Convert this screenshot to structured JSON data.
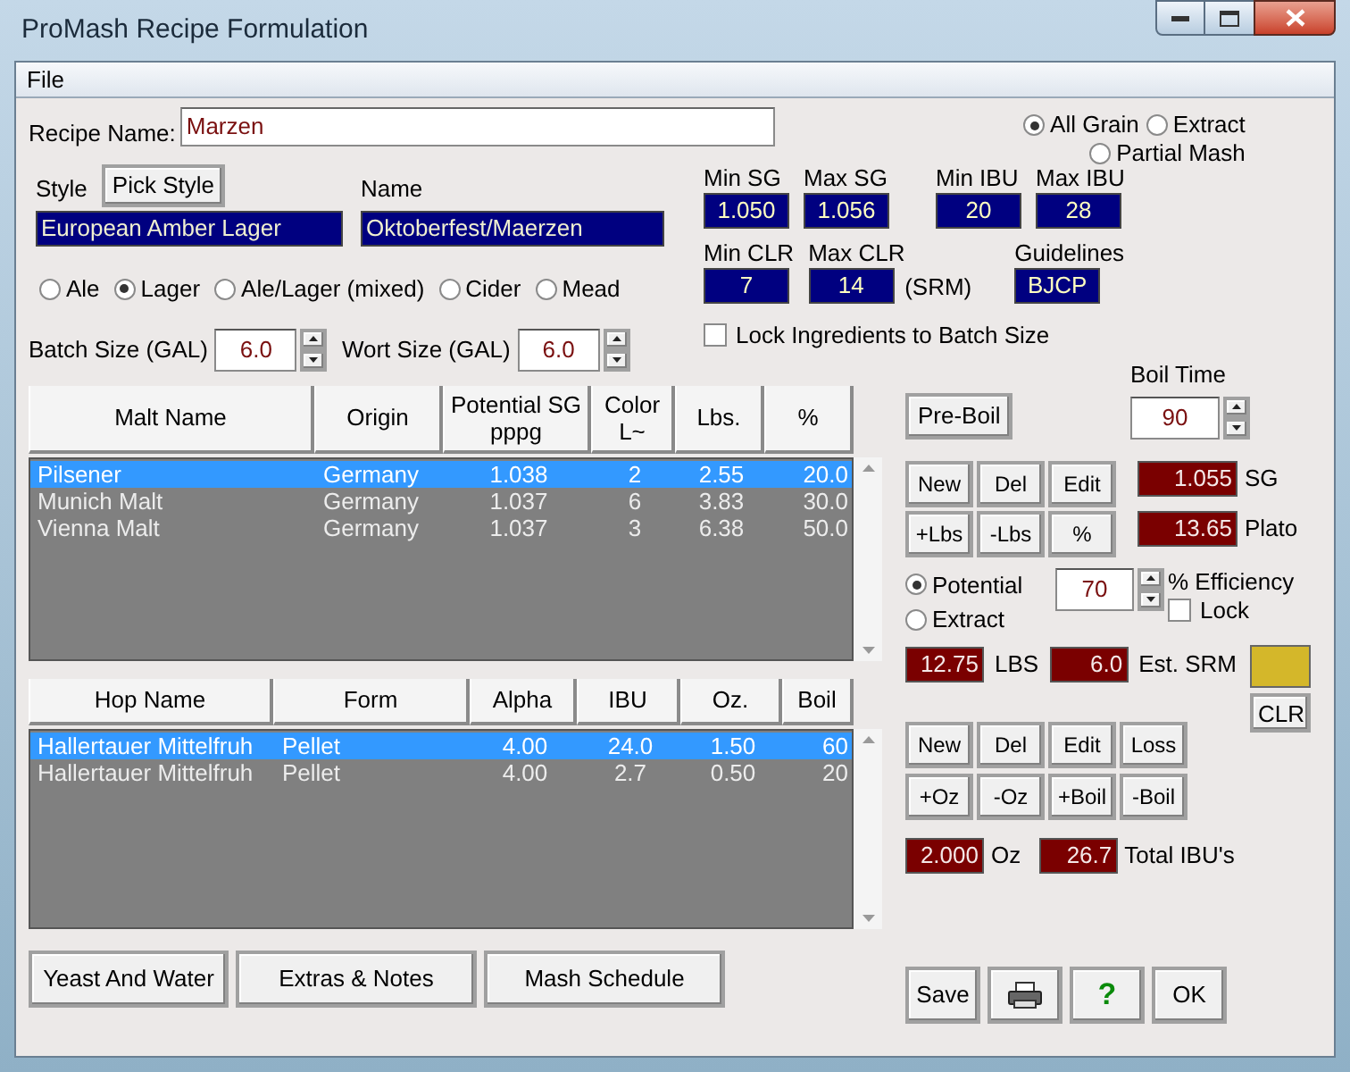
{
  "window": {
    "title": "ProMash Recipe Formulation"
  },
  "menu": [
    "File"
  ],
  "recipe_name": {
    "label": "Recipe Name:",
    "value": "Marzen"
  },
  "recipe_types": [
    {
      "label": "All Grain",
      "selected": true
    },
    {
      "label": "Extract",
      "selected": false
    },
    {
      "label": "Partial Mash",
      "selected": false
    }
  ],
  "style": {
    "label": "Style",
    "button": "Pick Style",
    "value": "European Amber Lager",
    "name_label": "Name",
    "name_value": "Oktoberfest/Maerzen"
  },
  "specs_row_1": [
    {
      "label": "Min SG",
      "value": "1.050"
    },
    {
      "label": "Max SG",
      "value": "1.056"
    },
    {
      "label": "Min IBU",
      "value": "20"
    },
    {
      "label": "Max IBU",
      "value": "28"
    }
  ],
  "specs_row_2": [
    {
      "label": "Min CLR",
      "value": "7"
    },
    {
      "label": "Max CLR",
      "value": "14"
    },
    {
      "label": "Guidelines",
      "value": "BJCP"
    }
  ],
  "color_unit": "(SRM)",
  "beer_types": [
    {
      "label": "Ale",
      "selected": false
    },
    {
      "label": "Lager",
      "selected": true
    },
    {
      "label": "Ale/Lager (mixed)",
      "selected": false
    },
    {
      "label": "Cider",
      "selected": false
    },
    {
      "label": "Mead",
      "selected": false
    }
  ],
  "batch_size": {
    "label": "Batch Size (GAL)",
    "value": "6.0"
  },
  "wort_size": {
    "label": "Wort Size (GAL)",
    "value": "6.0"
  },
  "lock_ingredients": {
    "label": "Lock Ingredients to Batch Size",
    "checked": false
  },
  "malt_table": {
    "columns": [
      "Malt Name",
      "Origin",
      "Potential SG pppg",
      "Color L~",
      "Lbs.",
      "%"
    ],
    "rows": [
      {
        "cells": [
          "Pilsener",
          "Germany",
          "1.038",
          "2",
          "2.55",
          "20.0"
        ],
        "selected": true
      },
      {
        "cells": [
          "Munich Malt",
          "Germany",
          "1.037",
          "6",
          "3.83",
          "30.0"
        ],
        "selected": false
      },
      {
        "cells": [
          "Vienna Malt",
          "Germany",
          "1.037",
          "3",
          "6.38",
          "50.0"
        ],
        "selected": false
      }
    ]
  },
  "hop_table": {
    "columns": [
      "Hop Name",
      "Form",
      "Alpha",
      "IBU",
      "Oz.",
      "Boil"
    ],
    "rows": [
      {
        "cells": [
          "Hallertauer Mittelfruh",
          "Pellet",
          "4.00",
          "24.0",
          "1.50",
          "60"
        ],
        "selected": true
      },
      {
        "cells": [
          "Hallertauer Mittelfruh",
          "Pellet",
          "4.00",
          "2.7",
          "0.50",
          "20"
        ],
        "selected": false
      }
    ]
  },
  "bottom_buttons": [
    "Yeast And Water",
    "Extras & Notes",
    "Mash Schedule"
  ],
  "pre_boil_button": "Pre-Boil",
  "boil_time": {
    "label": "Boil Time",
    "value": "90"
  },
  "malt_buttons": [
    "New",
    "Del",
    "Edit",
    "+Lbs",
    "-Lbs",
    "%"
  ],
  "gravity": [
    {
      "value": "1.055",
      "unit": "SG"
    },
    {
      "value": "13.65",
      "unit": "Plato"
    }
  ],
  "efficiency_modes": [
    {
      "label": "Potential",
      "selected": true
    },
    {
      "label": "Extract",
      "selected": false
    }
  ],
  "efficiency": {
    "value": "70",
    "label": "% Efficiency"
  },
  "lock_efficiency": {
    "label": "Lock",
    "checked": false
  },
  "grain_totals": [
    {
      "value": "12.75",
      "unit": "LBS"
    },
    {
      "value": "6.0",
      "unit": "Est. SRM"
    }
  ],
  "srm_swatch": {
    "color": "#d4b72a"
  },
  "clr_button": "CLR",
  "hop_buttons": [
    "New",
    "Del",
    "Edit",
    "Loss",
    "+Oz",
    "-Oz",
    "+Boil",
    "-Boil"
  ],
  "hop_totals": [
    {
      "value": "2.000",
      "unit": "Oz"
    },
    {
      "value": "26.7",
      "unit": "Total IBU's"
    }
  ],
  "dialog_buttons": [
    {
      "kind": "text",
      "label": "Save"
    },
    {
      "kind": "print"
    },
    {
      "kind": "help",
      "label": "?"
    },
    {
      "kind": "text",
      "label": "OK"
    }
  ]
}
